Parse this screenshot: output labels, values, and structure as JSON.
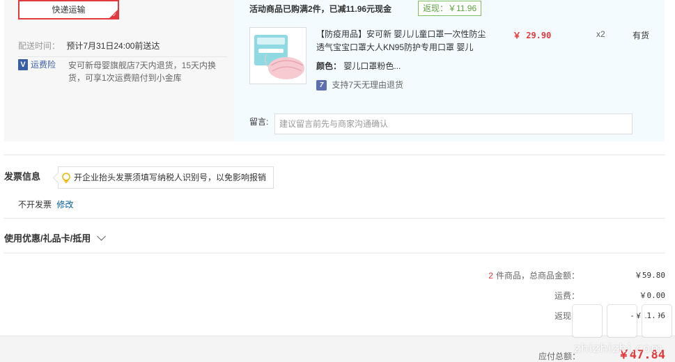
{
  "shipping": {
    "method_label": "快递运输",
    "delivery_label": "配送时间：",
    "delivery_value": "预计7月31日24:00前送达",
    "insurance_icon": "V",
    "insurance_label": "运费险",
    "insurance_text": "安可新母婴旗舰店7天内退货，15天内换货，可享1次运费赔付到小金库"
  },
  "promo": {
    "text": "活动商品已购满2件，已减11.96元现金",
    "rebate_tag": "返现：￥11.96"
  },
  "product": {
    "title": "【防疫用品】安可新 婴儿儿童口罩一次性防尘透气宝宝口罩大人KN95防护专用口罩 婴儿",
    "color_label": "颜色：",
    "color_value": "婴儿口罩粉色...",
    "return_icon": "7",
    "return_text": "支持7天无理由退货",
    "price": "￥ 29.90",
    "qty": "x2",
    "stock": "有货"
  },
  "message": {
    "label": "留言:",
    "placeholder": "建议留言前先与商家沟通确认"
  },
  "invoice": {
    "title": "发票信息",
    "tip": "开企业抬头发票须填写纳税人识别号，以免影响报销",
    "status": "不开发票",
    "edit_label": "修改"
  },
  "coupon": {
    "label": "使用优惠/礼品卡/抵用"
  },
  "totals": {
    "count": "2",
    "count_label": "件商品，总商品金额：",
    "goods_amount": "￥59.80",
    "freight_label": "运费：",
    "freight": "￥0.00",
    "rebate_label": "返现：",
    "rebate": "-￥11.96",
    "pay_label": "应付总额：",
    "pay_amount": "￥47.84"
  },
  "watermark": {
    "text": "zhizhizhi.com"
  },
  "colors": {
    "accent_red": "#e4393c",
    "link_blue": "#005ea7",
    "rebate_green": "#5aa33a"
  }
}
